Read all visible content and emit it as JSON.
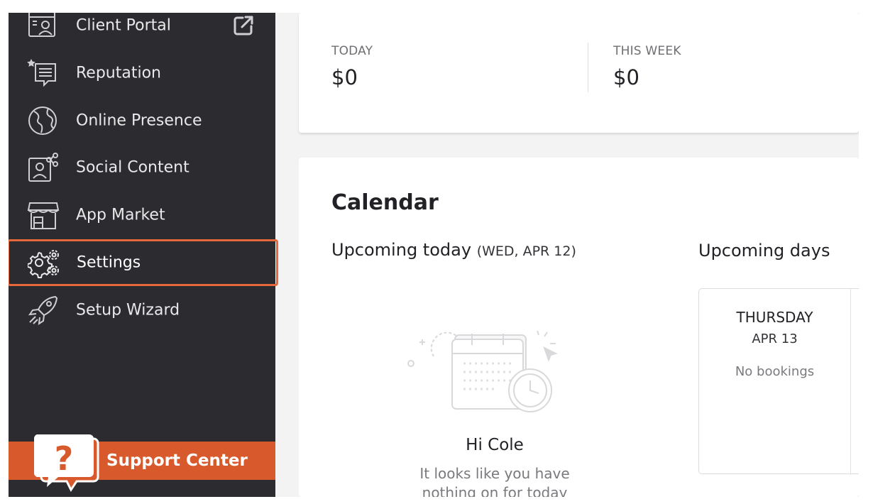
{
  "sidebar": {
    "items": [
      {
        "label": "Client Portal",
        "icon": "client-portal-icon"
      },
      {
        "label": "Reputation",
        "icon": "reputation-icon"
      },
      {
        "label": "Online Presence",
        "icon": "globe-icon"
      },
      {
        "label": "Social Content",
        "icon": "social-content-icon"
      },
      {
        "label": "App Market",
        "icon": "storefront-icon"
      },
      {
        "label": "Settings",
        "icon": "gears-icon",
        "active": true
      },
      {
        "label": "Setup Wizard",
        "icon": "rocket-icon"
      }
    ],
    "support_label": "Support Center"
  },
  "stats": {
    "today_label": "TODAY",
    "today_value": "$0",
    "week_label": "THIS WEEK",
    "week_value": "$0"
  },
  "calendar": {
    "title": "Calendar",
    "today_heading": "Upcoming today",
    "today_date": "(WED,  APR 12)",
    "days_heading": "Upcoming days",
    "empty_greeting": "Hi Cole",
    "empty_message_line1": "It looks like you have",
    "empty_message_line2": "nothing on for today",
    "day_card": {
      "day": "THURSDAY",
      "date": "APR 13",
      "status": "No bookings"
    }
  },
  "colors": {
    "sidebar_bg": "#2c2b30",
    "accent": "#e4683b",
    "support_bg": "#d85a2c"
  }
}
